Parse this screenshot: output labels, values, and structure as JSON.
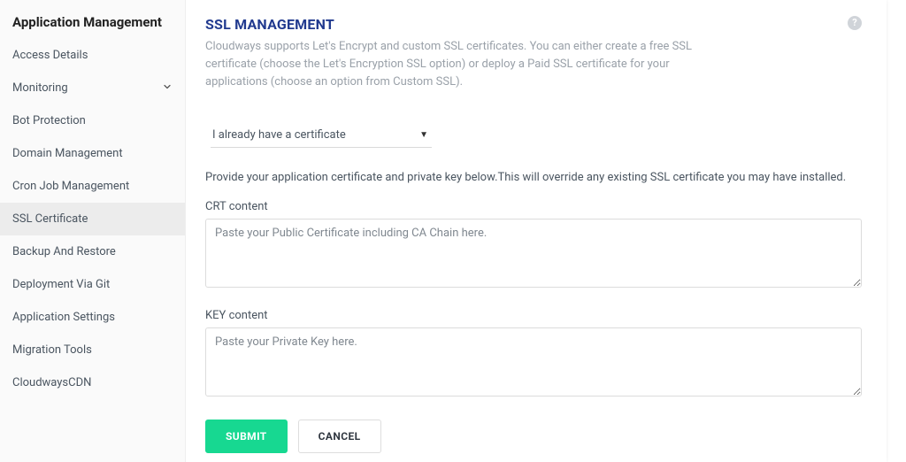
{
  "sidebar": {
    "heading": "Application Management",
    "items": [
      {
        "label": "Access Details",
        "active": false
      },
      {
        "label": "Monitoring",
        "active": false,
        "expandable": true
      },
      {
        "label": "Bot Protection",
        "active": false
      },
      {
        "label": "Domain Management",
        "active": false
      },
      {
        "label": "Cron Job Management",
        "active": false
      },
      {
        "label": "SSL Certificate",
        "active": true
      },
      {
        "label": "Backup And Restore",
        "active": false
      },
      {
        "label": "Deployment Via Git",
        "active": false
      },
      {
        "label": "Application Settings",
        "active": false
      },
      {
        "label": "Migration Tools",
        "active": false
      },
      {
        "label": "CloudwaysCDN",
        "active": false
      }
    ]
  },
  "main": {
    "title": "SSL MANAGEMENT",
    "description": "Cloudways supports Let's Encrypt and custom SSL certificates. You can either create a free SSL certificate (choose the Let's Encryption SSL option) or deploy a Paid SSL certificate for your applications (choose an option from Custom SSL).",
    "dropdown": {
      "selected": "I already have a certificate"
    },
    "hint": "Provide your application certificate and private key below.This will override any existing SSL certificate you may have installed.",
    "fields": {
      "crt": {
        "label": "CRT content",
        "placeholder": "Paste your Public Certificate including CA Chain here.",
        "value": ""
      },
      "key": {
        "label": "KEY content",
        "placeholder": "Paste your Private Key here.",
        "value": ""
      }
    },
    "buttons": {
      "submit": "SUBMIT",
      "cancel": "CANCEL"
    },
    "help_tooltip": "?"
  }
}
